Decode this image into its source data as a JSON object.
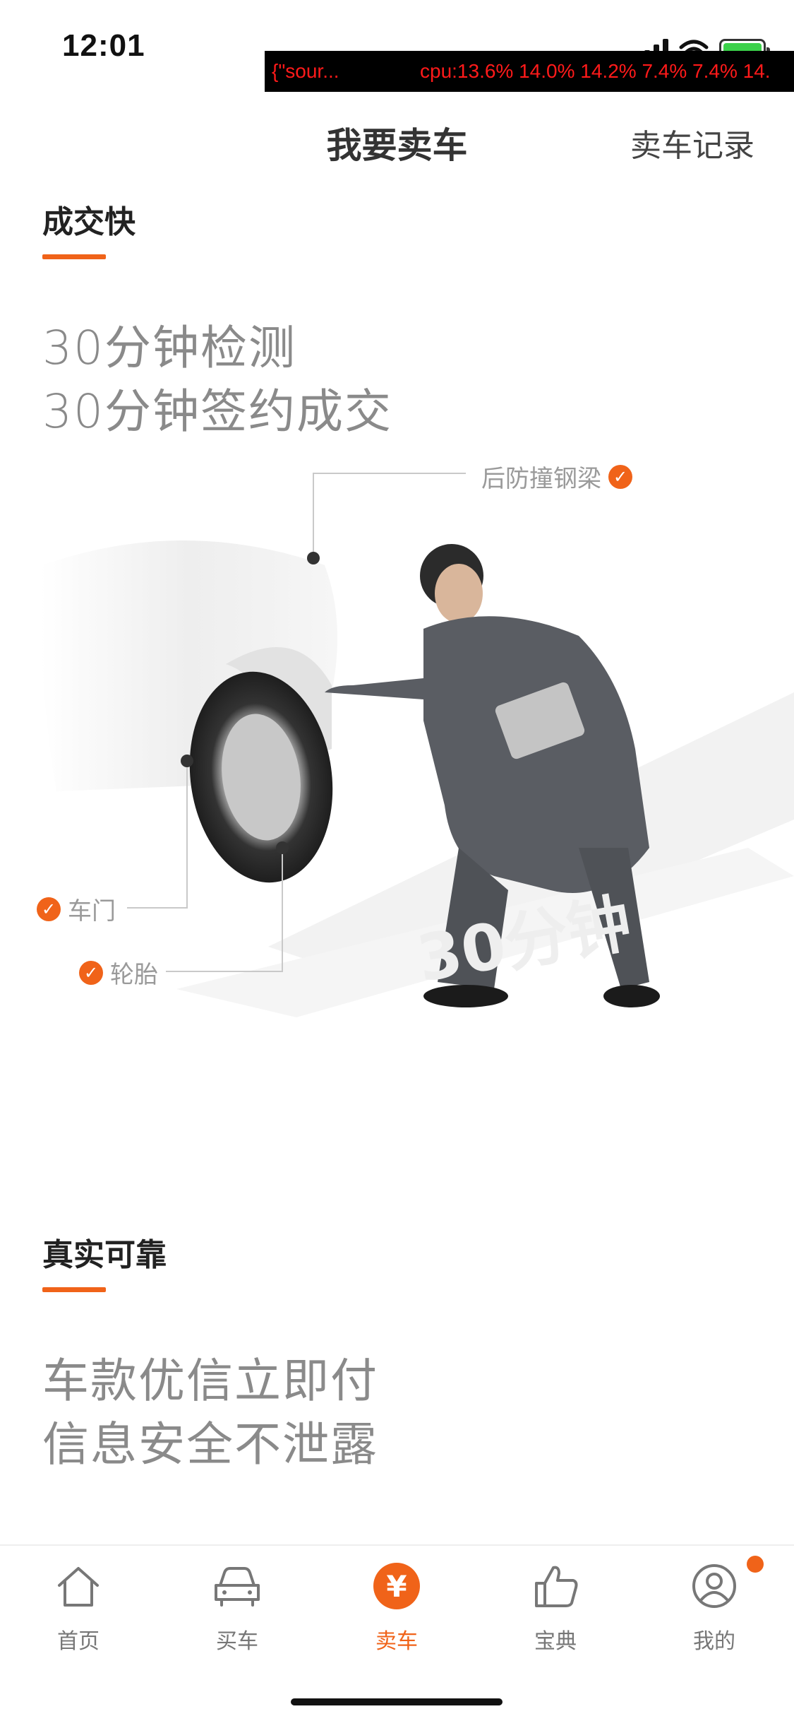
{
  "status_bar": {
    "time": "12:01",
    "debug_source": "{\"sour...",
    "debug_cpu": "cpu:13.6% 14.0% 14.2% 7.4% 7.4% 14.",
    "battery_color": "#3bd14a"
  },
  "nav": {
    "title": "我要卖车",
    "right_link": "卖车记录"
  },
  "section1": {
    "heading": "成交快",
    "tagline_line1": "30分钟检测",
    "tagline_line2": "30分钟签约成交",
    "callouts": {
      "bumper": "后防撞钢梁",
      "door": "车门",
      "tire": "轮胎"
    },
    "watermark": "30分钟"
  },
  "section2": {
    "heading": "真实可靠",
    "tagline_line1": "车款优信立即付",
    "tagline_line2": "信息安全不泄露"
  },
  "tab_bar": {
    "active_index": 2,
    "accent_color": "#f06319",
    "items": [
      {
        "label": "首页",
        "icon": "home-icon"
      },
      {
        "label": "买车",
        "icon": "car-icon"
      },
      {
        "label": "卖车",
        "icon": "yen-icon",
        "glyph": "¥"
      },
      {
        "label": "宝典",
        "icon": "thumbs-up-icon"
      },
      {
        "label": "我的",
        "icon": "user-icon"
      }
    ]
  }
}
